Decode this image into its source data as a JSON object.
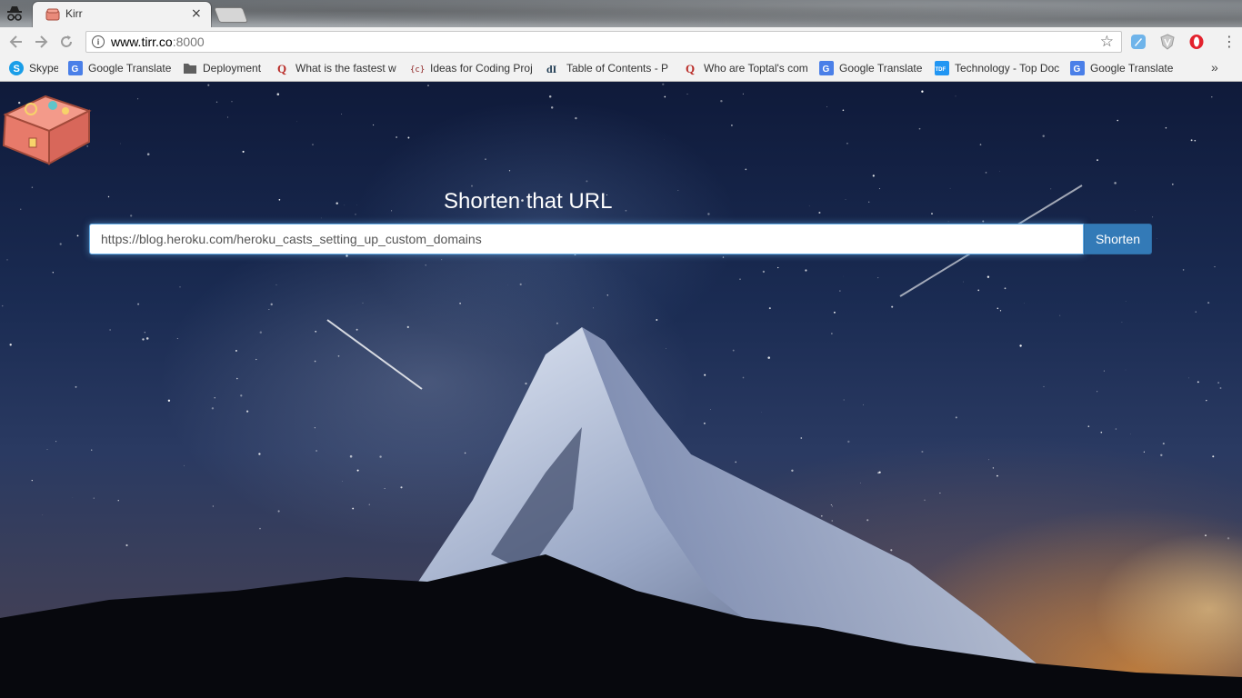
{
  "browser": {
    "tab": {
      "title": "Kirr",
      "close": "×"
    },
    "address": {
      "host": "www.tirr.co",
      "port": ":8000"
    },
    "bookmarks": [
      {
        "label": "Skype",
        "icon": "skype-icon",
        "color": "#1a9ee8"
      },
      {
        "label": "Google Translate",
        "icon": "google-translate-icon",
        "color": "#4a7fe8"
      },
      {
        "label": "Deployment",
        "icon": "folder-icon",
        "color": "#5f5f5f"
      },
      {
        "label": "What is the fastest w",
        "icon": "quora-icon",
        "color": "#b92b27"
      },
      {
        "label": "Ideas for Coding Proj",
        "icon": "codecode-icon",
        "color": "#8b1d1d"
      },
      {
        "label": "Table of Contents - P",
        "icon": "dive-into-python-icon",
        "color": "#1f3b52"
      },
      {
        "label": "Who are Toptal's com",
        "icon": "quora-icon",
        "color": "#b92b27"
      },
      {
        "label": "Google Translate",
        "icon": "google-translate-icon",
        "color": "#4a7fe8"
      },
      {
        "label": "Technology - Top Doc",
        "icon": "tdf-icon",
        "color": "#2196f3"
      },
      {
        "label": "Google Translate",
        "icon": "google-translate-icon",
        "color": "#4a7fe8"
      }
    ],
    "more": "»"
  },
  "page": {
    "heading": "Shorten that URL",
    "url_value": "https://blog.heroku.com/heroku_casts_setting_up_custom_domains",
    "button": "Shorten"
  },
  "colors": {
    "button": "#337ab7",
    "input_focus": "#66afe9"
  }
}
